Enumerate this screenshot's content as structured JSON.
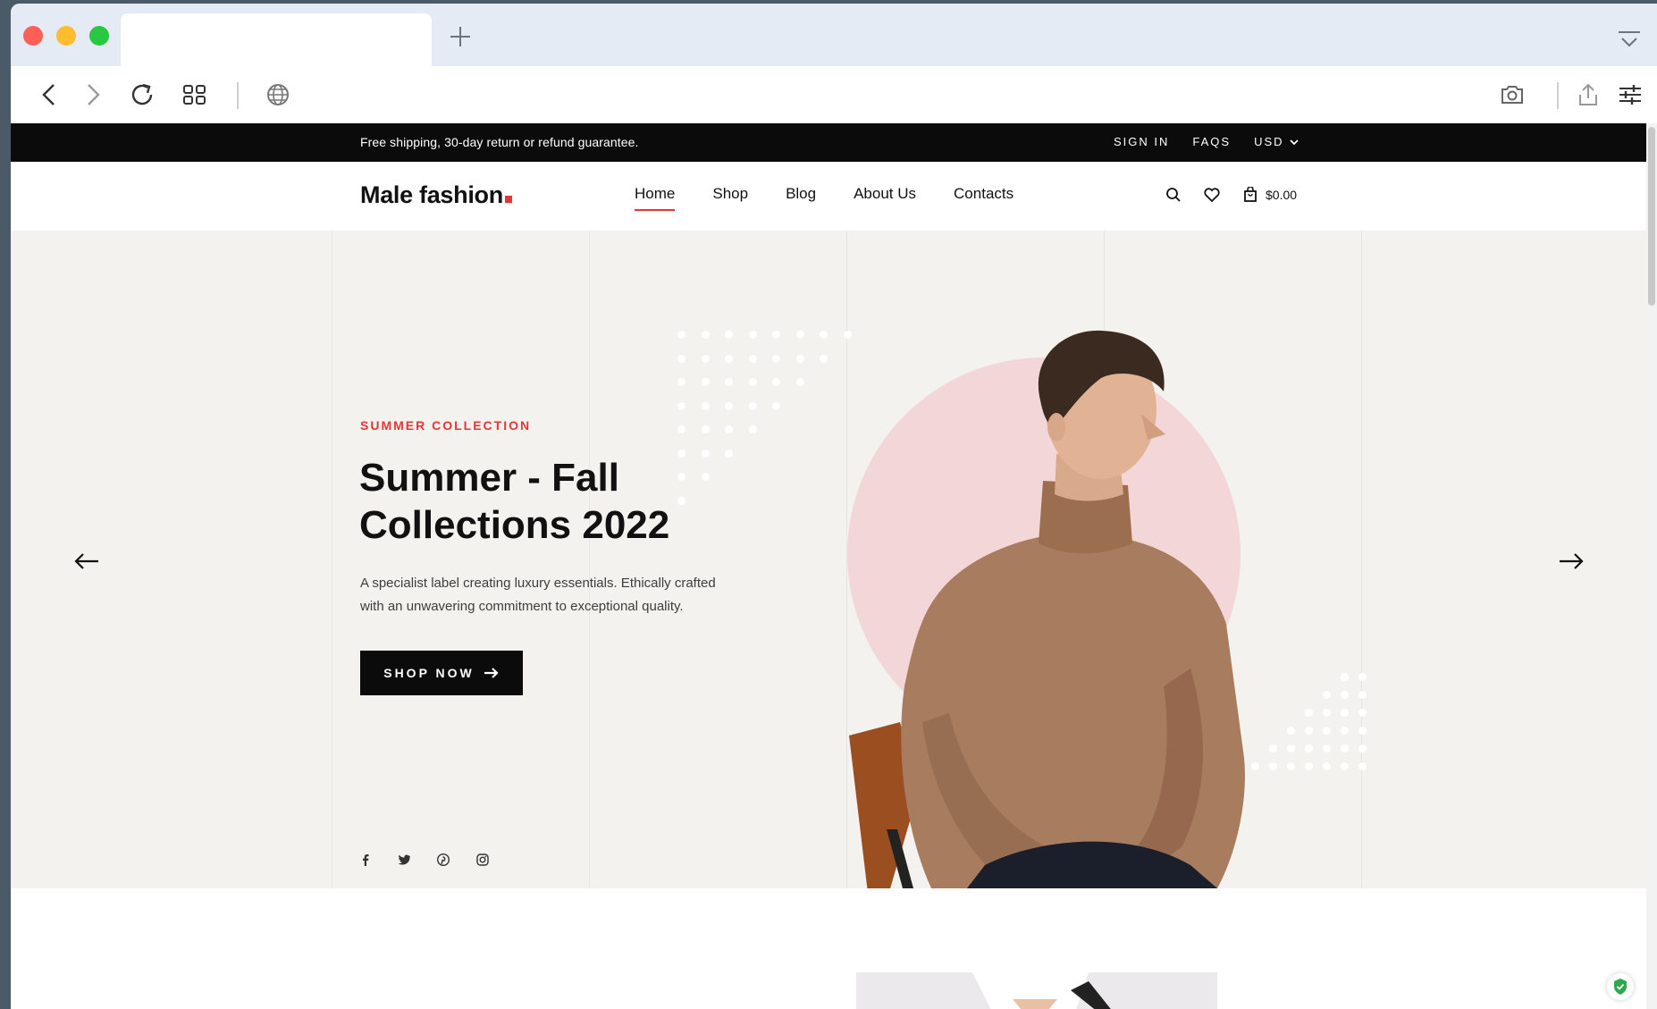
{
  "browser": {
    "tab_title": "",
    "icons": {
      "back": "chevron-left-icon",
      "forward": "chevron-right-icon",
      "reload": "reload-icon",
      "tabs_overview": "grid-icon",
      "site": "globe-icon",
      "screenshot": "camera-icon",
      "share": "share-icon",
      "settings": "sliders-icon",
      "new_tab": "plus-icon",
      "tab_menu": "tab-menu-icon"
    }
  },
  "announcement": {
    "message": "Free shipping, 30-day return or refund guarantee.",
    "sign_in": "SIGN IN",
    "faqs": "FAQS",
    "currency": "USD"
  },
  "header": {
    "logo_text": "Male fashion",
    "nav": [
      "Home",
      "Shop",
      "Blog",
      "About Us",
      "Contacts"
    ],
    "active_nav": "Home",
    "cart_total": "$0.00"
  },
  "hero": {
    "eyebrow": "SUMMER COLLECTION",
    "headline_line1": "Summer - Fall",
    "headline_line2": "Collections 2022",
    "description": "A specialist label creating luxury essentials. Ethically crafted with an unwavering commitment to exceptional quality.",
    "cta": "SHOP NOW",
    "socials": [
      "facebook-icon",
      "twitter-icon",
      "pinterest-icon",
      "instagram-icon"
    ]
  },
  "colors": {
    "accent": "#e53637",
    "dark": "#0b0b0b",
    "hero_bg": "#f3f2ee",
    "circle": "#f3d6d7",
    "sweater": "#a87c5f"
  }
}
